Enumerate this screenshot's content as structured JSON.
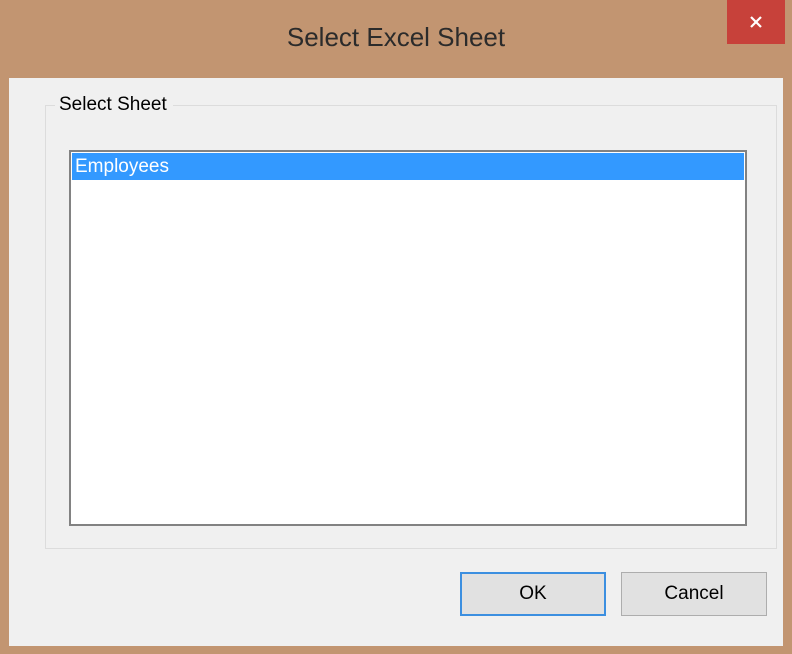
{
  "window": {
    "title": "Select Excel Sheet",
    "close_label": "✕"
  },
  "group": {
    "label": "Select Sheet"
  },
  "sheets": {
    "items": [
      "Employees"
    ],
    "selected": "Employees"
  },
  "buttons": {
    "ok_label": "OK",
    "cancel_label": "Cancel"
  },
  "colors": {
    "frame": "#c29571",
    "close": "#c7413a",
    "selection": "#3399ff",
    "dialog_bg": "#f0f0f0"
  }
}
